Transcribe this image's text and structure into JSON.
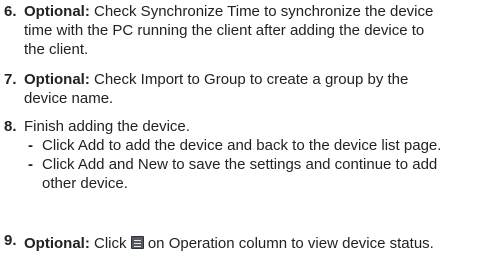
{
  "steps": [
    {
      "number": "6.",
      "optional": "Optional:",
      "lines": [
        "Check Synchronize Time to synchronize the device",
        "time with the PC running the client after adding the device to",
        "the client."
      ]
    },
    {
      "number": "7.",
      "optional": "Optional:",
      "lines": [
        "Check Import to Group to create a group by the",
        "device name."
      ]
    },
    {
      "number": "8.",
      "lines": [
        "Finish adding the device."
      ],
      "subitems": [
        {
          "bullet": "-",
          "lines": [
            "Click Add to add the device and back to the device list page."
          ]
        },
        {
          "bullet": "-",
          "lines": [
            "Click Add and New to save the settings and continue to add",
            "other device."
          ]
        }
      ]
    },
    {
      "number": "9.",
      "optional": "Optional:",
      "text_before_icon": "Click",
      "icon": "operation-list-icon",
      "text_after_icon": "on Operation column to view device status."
    }
  ]
}
